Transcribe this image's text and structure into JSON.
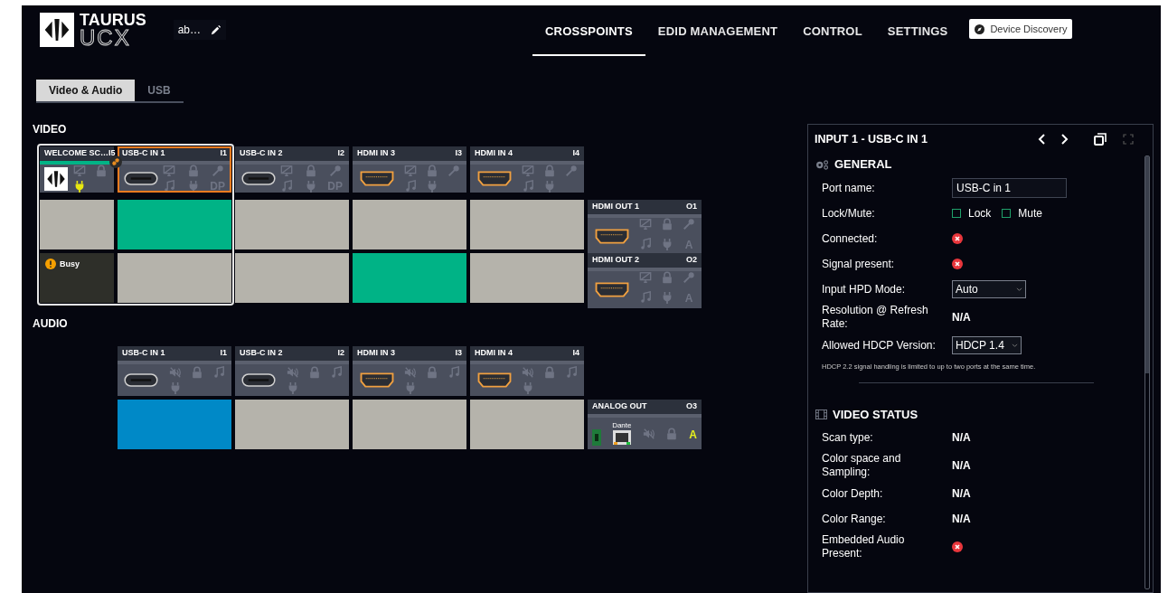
{
  "header": {
    "logo_top": "TAURUS",
    "logo_bottom": "UCX",
    "device_name": "ab…",
    "nav": [
      {
        "label": "CROSSPOINTS",
        "selected": true
      },
      {
        "label": "EDID MANAGEMENT",
        "selected": false
      },
      {
        "label": "CONTROL",
        "selected": false
      },
      {
        "label": "SETTINGS",
        "selected": false
      }
    ],
    "discovery_button": "Device Discovery"
  },
  "tabs": [
    {
      "label": "Video & Audio",
      "selected": true
    },
    {
      "label": "USB",
      "selected": false
    }
  ],
  "video": {
    "title": "VIDEO",
    "inputs": [
      {
        "kind": "welcome",
        "name": "WELCOME SC…",
        "port": "I5",
        "selected": false,
        "signal": true,
        "power_lit": true,
        "linked": true
      },
      {
        "kind": "usbc",
        "name": "USB-C IN 1",
        "port": "I1",
        "selected": true,
        "signal": false,
        "tag": "DP"
      },
      {
        "kind": "usbc",
        "name": "USB-C IN 2",
        "port": "I2",
        "selected": false,
        "signal": false,
        "tag": "DP"
      },
      {
        "kind": "hdmi",
        "name": "HDMI IN 3",
        "port": "I3",
        "selected": false,
        "signal": false
      },
      {
        "kind": "hdmi",
        "name": "HDMI IN 4",
        "port": "I4",
        "selected": false,
        "signal": false
      }
    ],
    "outputs": [
      {
        "kind": "hdmi",
        "name": "HDMI OUT 1",
        "port": "O1",
        "tag": "A",
        "tag_lit": false,
        "cells": [
          {
            "kind": "crosspoint",
            "on": false
          },
          {
            "kind": "crosspoint",
            "on": true
          },
          {
            "kind": "crosspoint",
            "on": false
          },
          {
            "kind": "crosspoint",
            "on": false
          },
          {
            "kind": "crosspoint",
            "on": false
          }
        ]
      },
      {
        "kind": "hdmi",
        "name": "HDMI OUT 2",
        "port": "O2",
        "tag": "A",
        "tag_lit": false,
        "cells": [
          {
            "kind": "busy",
            "label": "Busy"
          },
          {
            "kind": "crosspoint",
            "on": false
          },
          {
            "kind": "crosspoint",
            "on": false
          },
          {
            "kind": "crosspoint",
            "on": true
          },
          {
            "kind": "crosspoint",
            "on": false
          }
        ]
      }
    ]
  },
  "audio": {
    "title": "AUDIO",
    "inputs": [
      {
        "kind": "usbc",
        "name": "USB-C IN 1",
        "port": "I1"
      },
      {
        "kind": "usbc",
        "name": "USB-C IN 2",
        "port": "I2"
      },
      {
        "kind": "hdmi",
        "name": "HDMI IN 3",
        "port": "I3"
      },
      {
        "kind": "hdmi",
        "name": "HDMI IN 4",
        "port": "I4"
      }
    ],
    "outputs": [
      {
        "kind": "analog",
        "name": "ANALOG OUT",
        "port": "O3",
        "dante_label": "Dante",
        "tag": "A",
        "tag_lit": true,
        "cells": [
          {
            "kind": "crosspoint",
            "on": true
          },
          {
            "kind": "crosspoint",
            "on": false
          },
          {
            "kind": "crosspoint",
            "on": false
          },
          {
            "kind": "crosspoint",
            "on": false
          }
        ]
      }
    ]
  },
  "panel": {
    "title": "INPUT 1 - USB-C IN 1",
    "sections": [
      {
        "kind": "general",
        "title": "GENERAL",
        "rows": [
          {
            "kind": "input",
            "label": "Port name:",
            "value": "USB-C in 1"
          },
          {
            "kind": "checks",
            "label": "Lock/Mute:",
            "options": [
              {
                "label": "Lock",
                "checked": false
              },
              {
                "label": "Mute",
                "checked": false
              }
            ]
          },
          {
            "kind": "status",
            "label": "Connected:",
            "ok": false
          },
          {
            "kind": "status",
            "label": "Signal present:",
            "ok": false
          },
          {
            "kind": "select",
            "label": "Input HPD Mode:",
            "value": "Auto"
          },
          {
            "kind": "text",
            "label": "Resolution @ Refresh Rate:",
            "value": "N/A"
          },
          {
            "kind": "select",
            "label": "Allowed HDCP Version:",
            "value": "HDCP 1.4"
          },
          {
            "kind": "note",
            "text": "HDCP 2.2 signal handling is limited to up to two ports at the same time."
          }
        ]
      },
      {
        "kind": "video_status",
        "title": "VIDEO STATUS",
        "rows": [
          {
            "kind": "text",
            "label": "Scan type:",
            "value": "N/A"
          },
          {
            "kind": "text",
            "label": "Color space and Sampling:",
            "value": "N/A"
          },
          {
            "kind": "text",
            "label": "Color Depth:",
            "value": "N/A"
          },
          {
            "kind": "text",
            "label": "Color Range:",
            "value": "N/A"
          },
          {
            "kind": "status",
            "label": "Embedded Audio Present:",
            "ok": false
          }
        ]
      }
    ]
  }
}
